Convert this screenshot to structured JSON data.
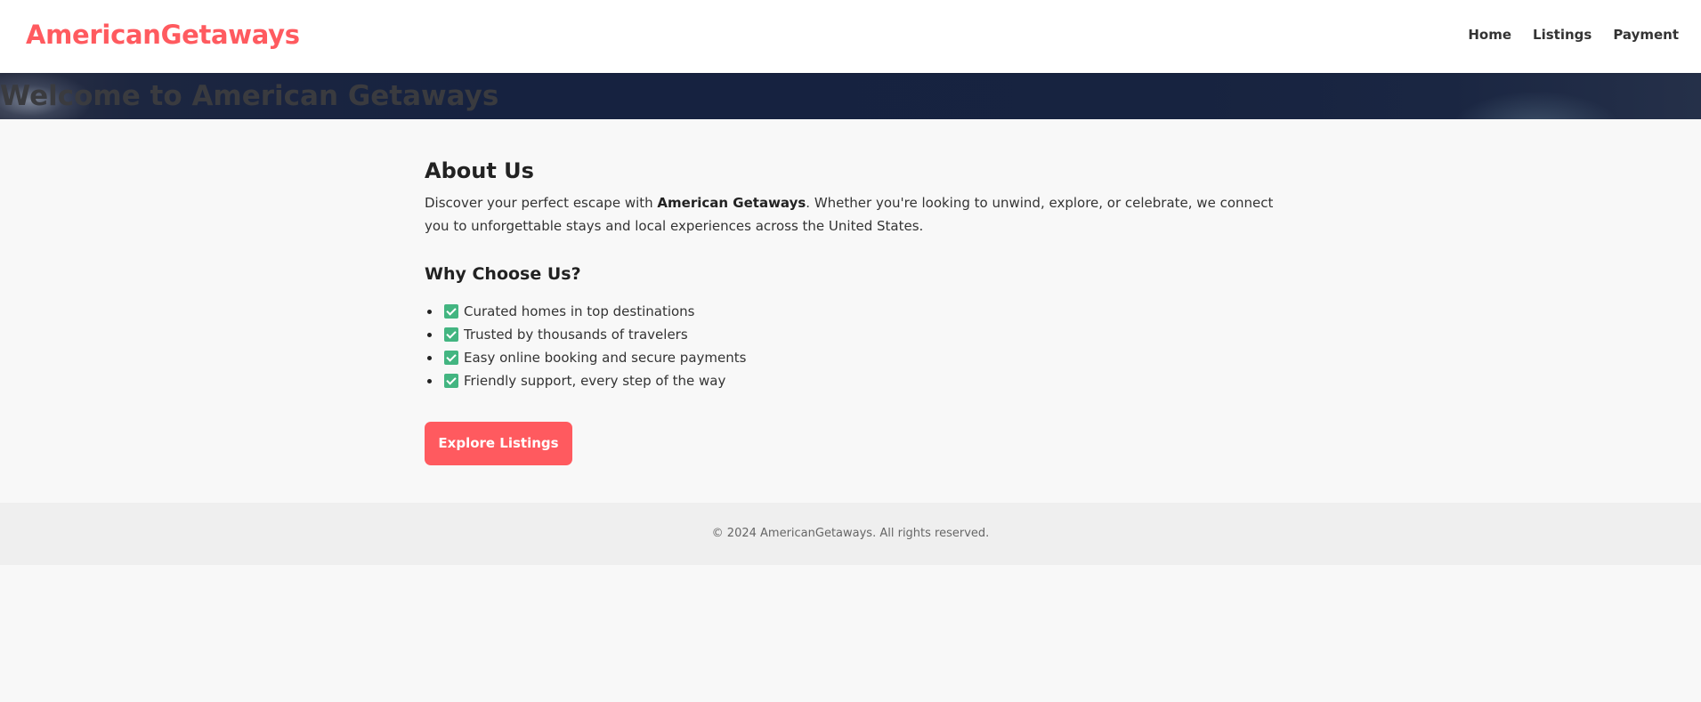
{
  "header": {
    "brand": "AmericanGetaways",
    "nav": [
      "Home",
      "Listings",
      "Payment"
    ]
  },
  "hero": {
    "title": "Welcome to American Getaways"
  },
  "about": {
    "title": "About Us",
    "text_before": "Discover your perfect escape with ",
    "text_bold": "American Getaways",
    "text_after": ". Whether you're looking to unwind, explore, or celebrate, we connect you to unforgettable stays and local experiences across the United States."
  },
  "why": {
    "title": "Why Choose Us?",
    "items": [
      "Curated homes in top destinations",
      "Trusted by thousands of travelers",
      "Easy online booking and secure payments",
      "Friendly support, every step of the way"
    ]
  },
  "cta": {
    "label": "Explore Listings"
  },
  "footer": {
    "text": "© 2024 AmericanGetaways. All rights reserved."
  },
  "colors": {
    "brand": "#ff5a5f",
    "check": "#43b581",
    "hero_bg": "#172340",
    "footer_bg": "#efefef"
  },
  "icons": {
    "feature_check": "check-box-icon"
  }
}
